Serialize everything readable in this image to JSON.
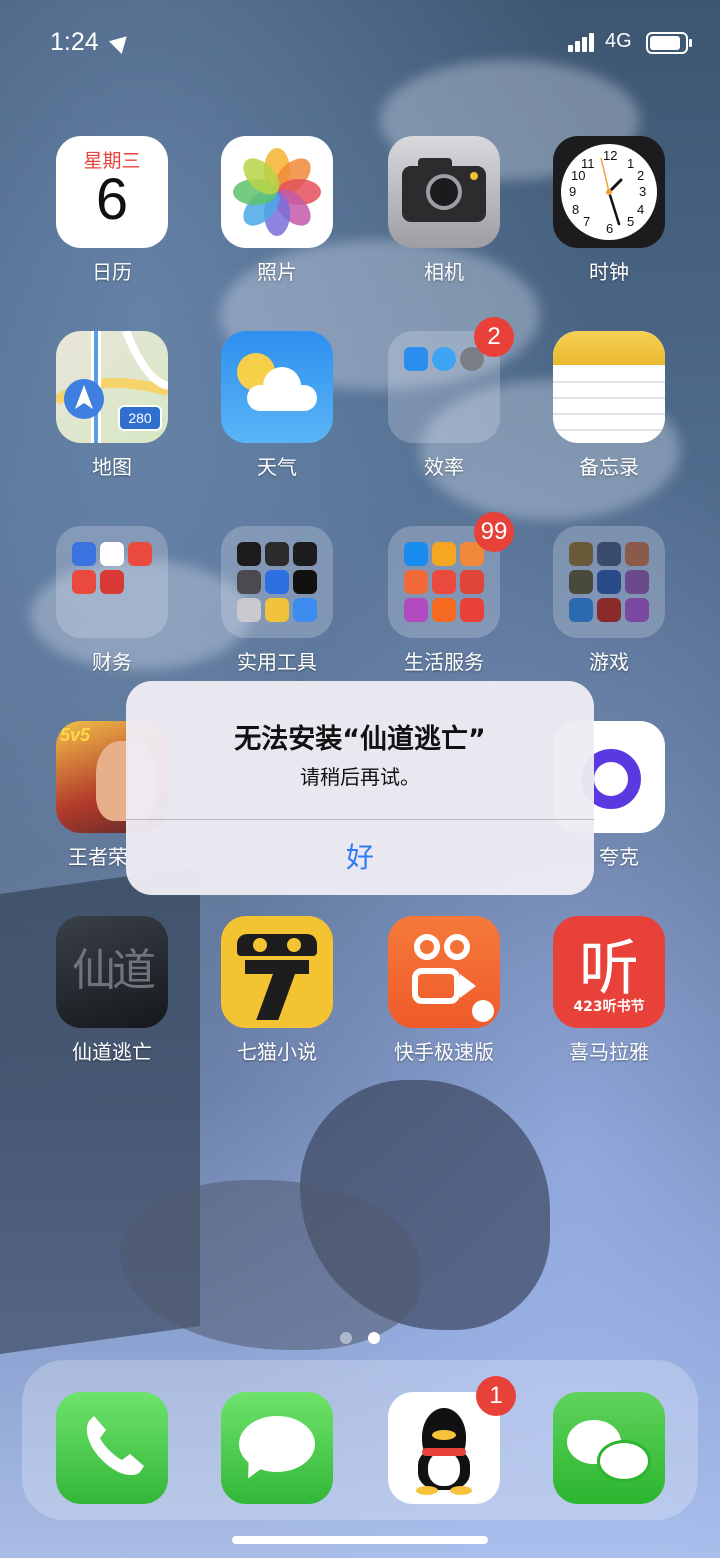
{
  "status_bar": {
    "time": "1:24",
    "network": "4G"
  },
  "home": {
    "rows": [
      [
        {
          "name": "calendar",
          "label": "日历",
          "day_of_week": "星期三",
          "day": "6"
        },
        {
          "name": "photos",
          "label": "照片"
        },
        {
          "name": "camera",
          "label": "相机"
        },
        {
          "name": "clock",
          "label": "时钟"
        }
      ],
      [
        {
          "name": "maps",
          "label": "地图",
          "shield": "280"
        },
        {
          "name": "weather",
          "label": "天气"
        },
        {
          "name": "folder-efficiency",
          "label": "效率",
          "badge": "2"
        },
        {
          "name": "notes",
          "label": "备忘录"
        }
      ],
      [
        {
          "name": "folder-finance",
          "label": "财务"
        },
        {
          "name": "folder-utilities",
          "label": "实用工具"
        },
        {
          "name": "folder-life-services",
          "label": "生活服务",
          "badge": "99"
        },
        {
          "name": "folder-games",
          "label": "游戏"
        }
      ],
      [
        {
          "name": "honor-of-kings",
          "label": "王者荣",
          "badge_text": "5v5"
        },
        {
          "name": "quark",
          "label": "夸克"
        }
      ],
      [
        {
          "name": "xiandao-taowang",
          "label": "仙道逃亡",
          "art_text": "仙道"
        },
        {
          "name": "qimao-novel",
          "label": "七猫小说"
        },
        {
          "name": "kuaishou-lite",
          "label": "快手极速版"
        },
        {
          "name": "ximalaya",
          "label": "喜马拉雅",
          "glyph": "听",
          "subtitle": "423听书节"
        }
      ]
    ]
  },
  "page_dots": {
    "count": 2,
    "current": 2
  },
  "dock": [
    {
      "name": "phone"
    },
    {
      "name": "messages"
    },
    {
      "name": "qq",
      "badge": "1"
    },
    {
      "name": "wechat"
    }
  ],
  "alert": {
    "title": "无法安装“仙道逃亡”",
    "message": "请稍后再试。",
    "button": "好"
  },
  "colors": {
    "badge": "#e8413a",
    "alert_button": "#2f7bf6"
  }
}
